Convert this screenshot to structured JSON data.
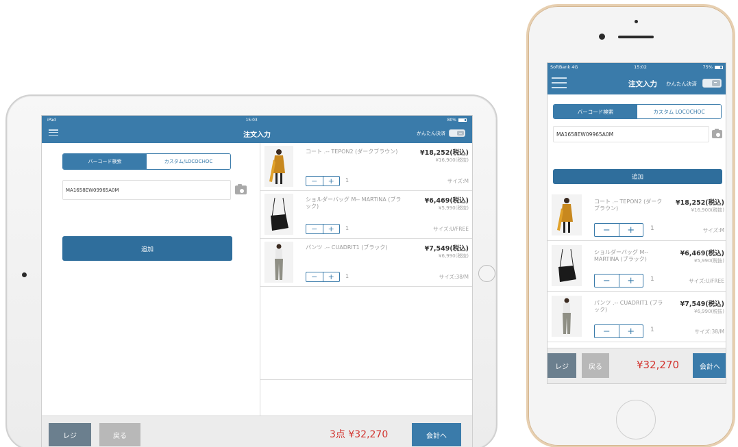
{
  "ipad": {
    "status": {
      "left": "iPad",
      "time": "15:03",
      "battery": "80%",
      "battery_level": 0.8
    },
    "nav": {
      "title": "注文入力",
      "quick_label": "かんたん決済"
    },
    "tabs": [
      {
        "label": "バーコード検索",
        "active": true
      },
      {
        "label": "カスタム/LOCOCHOC",
        "active": false
      }
    ],
    "barcode_value": "MA1658EW09965A0M",
    "add_label": "追加",
    "footer": {
      "regi": "レジ",
      "back": "戻る",
      "total": "3点 ¥32,270",
      "checkout": "会計へ"
    }
  },
  "iphone": {
    "status": {
      "carrier": "SoftBank 4G",
      "time": "15:02",
      "battery": "75%",
      "battery_level": 0.75
    },
    "nav": {
      "title": "注文入力",
      "quick_label": "かんたん決済"
    },
    "tabs": [
      {
        "label": "バーコード検索",
        "active": true
      },
      {
        "label": "カスタム LOCOCHOC",
        "active": false
      }
    ],
    "barcode_value": "MA1658EW09965A0M",
    "add_label": "追加",
    "footer": {
      "regi": "レジ",
      "back": "戻る",
      "total": "¥32,270",
      "checkout": "会計へ"
    }
  },
  "items": [
    {
      "name": "コート .-- TEPON2 (ダークブラウン)",
      "price": "¥18,252(税込)",
      "pretax": "¥16,900(税抜)",
      "qty": "1",
      "size": "サイズ:M",
      "thumb": "coat"
    },
    {
      "name": "ショルダーバッグ M-- MARTINA (ブラック)",
      "price": "¥6,469(税込)",
      "pretax": "¥5,990(税抜)",
      "qty": "1",
      "size": "サイズ:U/FREE",
      "thumb": "bag"
    },
    {
      "name": "パンツ .-- CUADRIT1 (ブラック)",
      "price": "¥7,549(税込)",
      "pretax": "¥6,990(税抜)",
      "qty": "1",
      "size": "サイズ:38/M",
      "thumb": "pants"
    }
  ],
  "stepper": {
    "minus": "−",
    "plus": "+"
  },
  "colors": {
    "primary": "#3a7baa",
    "total": "#d2322d",
    "regi": "#6b7f8e",
    "back": "#b8b8b8"
  }
}
